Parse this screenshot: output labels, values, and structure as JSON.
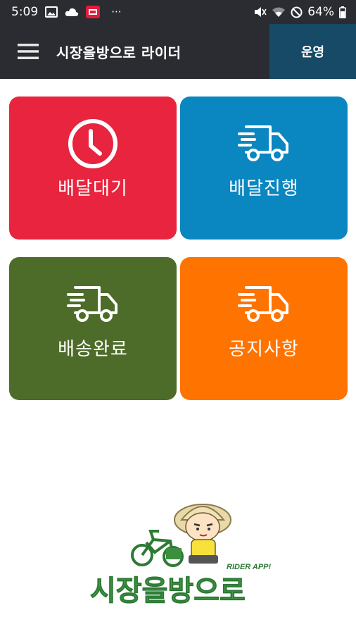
{
  "status_bar": {
    "time": "5:09",
    "battery": "64%",
    "more_indicator": "···"
  },
  "app_bar": {
    "title": "시장을방으로 라이더",
    "mode_button": "운영"
  },
  "tiles": [
    {
      "label": "배달대기",
      "icon": "clock-icon",
      "color": "#e8243e"
    },
    {
      "label": "배달진행",
      "icon": "delivery-truck-icon",
      "color": "#0a86c0"
    },
    {
      "label": "배송완료",
      "icon": "delivery-truck-icon",
      "color": "#4e6c29"
    },
    {
      "label": "공지사항",
      "icon": "delivery-truck-icon",
      "color": "#ff7300"
    }
  ],
  "logo": {
    "wordmark": "시장을방으로",
    "tagline": "RIDER APP!"
  }
}
